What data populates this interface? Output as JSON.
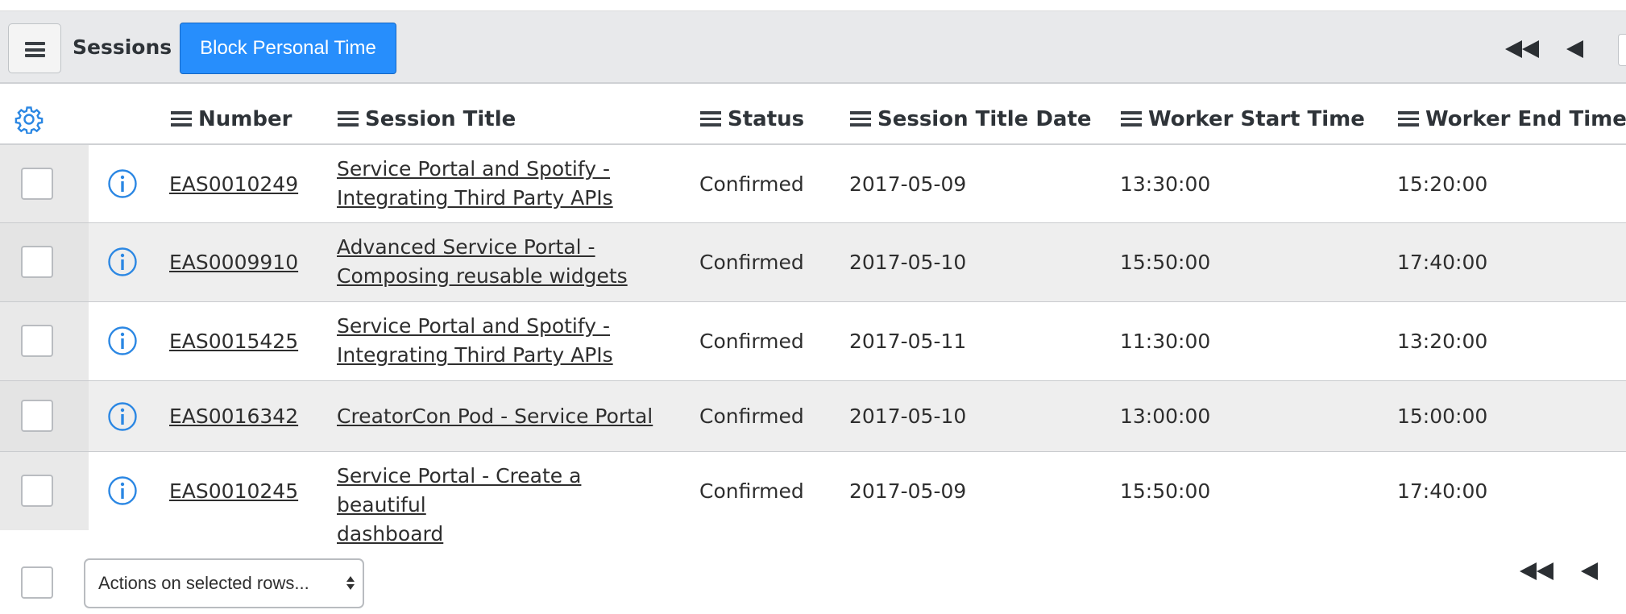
{
  "toolbar": {
    "title": "Sessions",
    "primary_button": "Block Personal Time"
  },
  "columns": [
    {
      "label": "Number"
    },
    {
      "label": "Session Title"
    },
    {
      "label": "Status"
    },
    {
      "label": "Session Title Date"
    },
    {
      "label": "Worker Start Time"
    },
    {
      "label": "Worker End Time"
    }
  ],
  "rows": [
    {
      "number": "EAS0010249",
      "title_line1": "Service Portal and Spotify -",
      "title_line2": "Integrating Third Party APIs",
      "status": "Confirmed",
      "date": "2017-05-09",
      "start": "13:30:00",
      "end": "15:20:00"
    },
    {
      "number": "EAS0009910",
      "title_line1": "Advanced Service Portal -",
      "title_line2": "Composing reusable widgets",
      "status": "Confirmed",
      "date": "2017-05-10",
      "start": "15:50:00",
      "end": "17:40:00"
    },
    {
      "number": "EAS0015425",
      "title_line1": "Service Portal and Spotify -",
      "title_line2": "Integrating Third Party APIs",
      "status": "Confirmed",
      "date": "2017-05-11",
      "start": "11:30:00",
      "end": "13:20:00"
    },
    {
      "number": "EAS0016342",
      "title_line1": "CreatorCon Pod - Service Portal",
      "title_line2": "",
      "status": "Confirmed",
      "date": "2017-05-10",
      "start": "13:00:00",
      "end": "15:00:00"
    },
    {
      "number": "EAS0010245",
      "title_line1": "Service Portal - Create a beautiful",
      "title_line2": "dashboard",
      "status": "Confirmed",
      "date": "2017-05-09",
      "start": "15:50:00",
      "end": "17:40:00"
    }
  ],
  "footer": {
    "actions_select": "Actions on selected rows..."
  },
  "colors": {
    "accent": "#278efc",
    "info_icon": "#2b87e3",
    "toolbar_bg": "#e8e9eb"
  }
}
